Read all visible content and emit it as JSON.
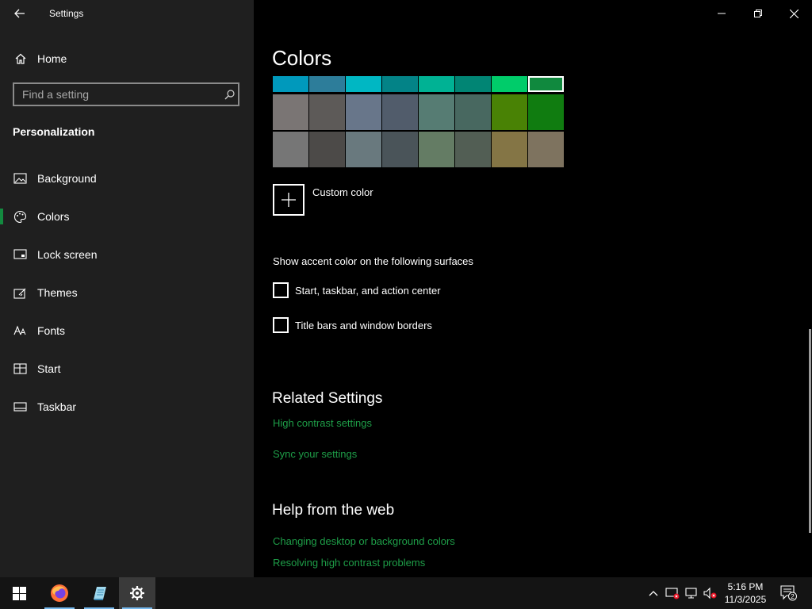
{
  "app": {
    "title": "Settings"
  },
  "sidebar": {
    "home_label": "Home",
    "search_placeholder": "Find a setting",
    "section_title": "Personalization",
    "items": [
      {
        "label": "Background",
        "icon": "image-icon"
      },
      {
        "label": "Colors",
        "icon": "palette-icon",
        "active": true
      },
      {
        "label": "Lock screen",
        "icon": "lock-screen-icon"
      },
      {
        "label": "Themes",
        "icon": "themes-icon"
      },
      {
        "label": "Fonts",
        "icon": "fonts-icon"
      },
      {
        "label": "Start",
        "icon": "start-icon"
      },
      {
        "label": "Taskbar",
        "icon": "taskbar-icon"
      }
    ]
  },
  "main": {
    "title": "Colors",
    "swatch_rows": [
      [
        "#0099bc",
        "#2d7d9a",
        "#00b7c3",
        "#038387",
        "#00b294",
        "#018574",
        "#00cc6a",
        "#10893e"
      ],
      [
        "#7a7574",
        "#5d5a58",
        "#68768a",
        "#515c6b",
        "#567c73",
        "#486860",
        "#498205",
        "#107c10"
      ],
      [
        "#767676",
        "#4c4a48",
        "#69797e",
        "#4a5459",
        "#647c64",
        "#525e54",
        "#847545",
        "#7e735f"
      ]
    ],
    "selected_swatch": "#10893e",
    "custom_color_label": "Custom color",
    "surfaces_label": "Show accent color on the following surfaces",
    "checkbox_start": "Start, taskbar, and action center",
    "checkbox_titlebars": "Title bars and window borders",
    "related_title": "Related Settings",
    "link_high_contrast": "High contrast settings",
    "link_sync": "Sync your settings",
    "help_title": "Help from the web",
    "link_change_desktop": "Changing desktop or background colors",
    "link_resolve_contrast": "Resolving high contrast problems"
  },
  "accent_color": "#1e9e48",
  "taskbar": {
    "clock_time": "5:16 PM",
    "clock_date": "11/3/2025",
    "notification_count": "2"
  }
}
